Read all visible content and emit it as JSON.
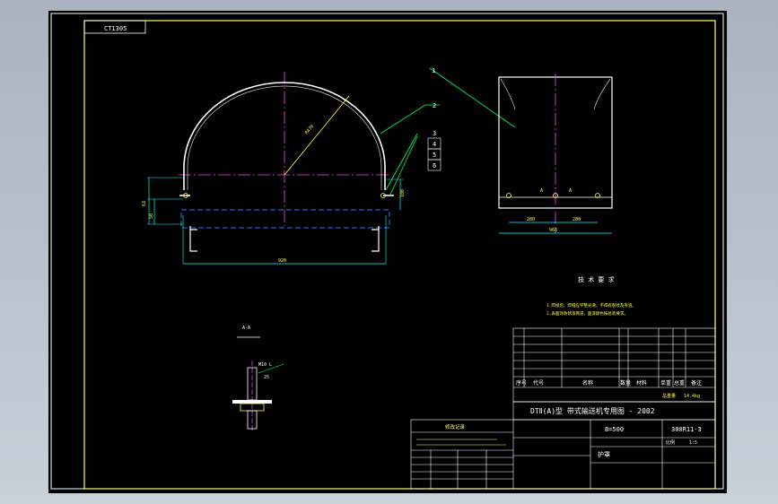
{
  "sheet": {
    "code_box": "CT1305"
  },
  "balloons": [
    "1",
    "2",
    "3",
    "4",
    "5",
    "6"
  ],
  "front_view": {
    "dim_width": "920",
    "dim_radius": "R470",
    "dim_left_height": "63",
    "dim_left_lower": "50",
    "dim_right_height": "100"
  },
  "side_view": {
    "dim_bottom": "968",
    "dim_left": "280",
    "dim_right": "280",
    "mark_a1": "A",
    "mark_a2": "A"
  },
  "section_view": {
    "section_label": "A-A",
    "part_note": "M10 L",
    "part_note2": "25"
  },
  "tech_req": {
    "title": "技 术 要 求",
    "line1": "1.焊接后，焊缝应平整光滑，不得有裂纹及夹渣。",
    "line2": "2.表面涂防锈漆两道，面漆颜色按总装要求。"
  },
  "title_block": {
    "product_title": "DTⅡ(A)型 带式输送机专用图 - 2002",
    "belt_width": "B=500",
    "drawing_number": "300R11-3",
    "part_name": "护罩",
    "bom_header": [
      "序号",
      "代号",
      "名称",
      "数量",
      "材料",
      "单重",
      "总重",
      "备注"
    ],
    "weight_label": "总重量",
    "weight_value": "14.4kg",
    "scale_label": "比例",
    "scale_value": "1:5"
  },
  "change_table": {
    "title": "修改记录"
  }
}
